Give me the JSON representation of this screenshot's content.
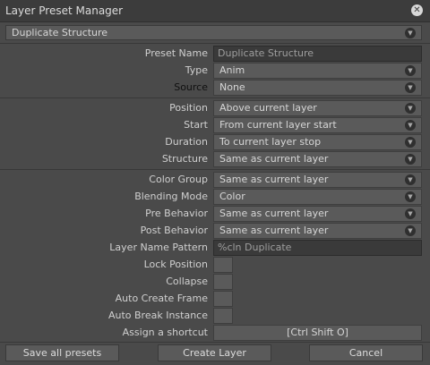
{
  "window": {
    "title": "Layer Preset Manager",
    "close_icon": "close-icon"
  },
  "preset_selector": {
    "value": "Duplicate Structure"
  },
  "fields": {
    "preset_name": {
      "label": "Preset Name",
      "value": "Duplicate Structure"
    },
    "type": {
      "label": "Type",
      "value": "Anim"
    },
    "source": {
      "label": "Source",
      "value": "None"
    },
    "position": {
      "label": "Position",
      "value": "Above current layer"
    },
    "start": {
      "label": "Start",
      "value": "From current layer start"
    },
    "duration": {
      "label": "Duration",
      "value": "To current layer stop"
    },
    "structure": {
      "label": "Structure",
      "value": "Same as current layer"
    },
    "color_group": {
      "label": "Color Group",
      "value": "Same as current layer"
    },
    "blending_mode": {
      "label": "Blending Mode",
      "value": "Color"
    },
    "pre_behavior": {
      "label": "Pre Behavior",
      "value": "Same as current layer"
    },
    "post_behavior": {
      "label": "Post Behavior",
      "value": "Same as current layer"
    },
    "layer_name_pattern": {
      "label": "Layer Name Pattern",
      "value": "%cln Duplicate"
    },
    "lock_position": {
      "label": "Lock Position",
      "checked": false
    },
    "collapse": {
      "label": "Collapse",
      "checked": false
    },
    "auto_create_frame": {
      "label": "Auto Create Frame",
      "checked": false
    },
    "auto_break_instance": {
      "label": "Auto Break Instance",
      "checked": false
    },
    "assign_shortcut": {
      "label": "Assign a shortcut",
      "value": "[Ctrl Shift O]"
    }
  },
  "buttons": {
    "save_all": "Save all presets",
    "create_layer": "Create Layer",
    "cancel": "Cancel"
  },
  "colors": {
    "background": "#4a4a4a",
    "field": "#5a5a5a",
    "input": "#3a3a3a",
    "titlebar": "#3c3c3c"
  }
}
